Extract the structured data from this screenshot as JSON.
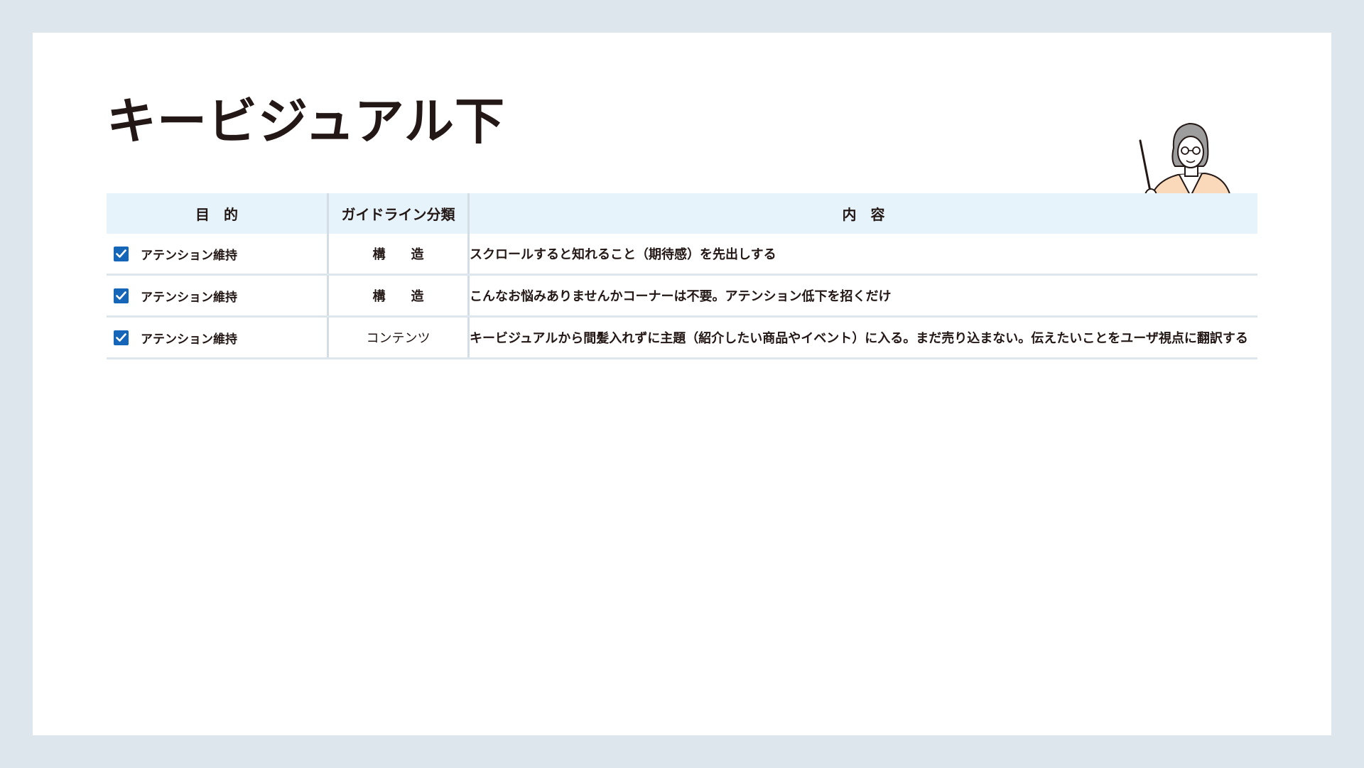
{
  "title": "キービジュアル下",
  "table": {
    "headers": {
      "purpose": "目　的",
      "category": "ガイドライン分類",
      "content": "内　容"
    },
    "rows": [
      {
        "checked": true,
        "purpose": "アテンション維持",
        "category": "構　　造",
        "content": "スクロールすると知れること（期待感）を先出しする"
      },
      {
        "checked": true,
        "purpose": "アテンション維持",
        "category": "構　　造",
        "content": "こんなお悩みありませんかコーナーは不要。アテンション低下を招くだけ"
      },
      {
        "checked": true,
        "purpose": "アテンション維持",
        "category": "コンテンツ",
        "content": "キービジュアルから間髪入れずに主題（紹介したい商品やイベント）に入る。まだ売り込まない。伝えたいことをユーザ視点に翻訳する"
      }
    ]
  },
  "colors": {
    "checkbox": "#1565b8",
    "header_bg": "#e7f3fb",
    "frame": "#dde6ed",
    "title": "#231815"
  },
  "icons": {
    "illustration": "teacher-with-pointer-icon",
    "check": "check-icon"
  }
}
